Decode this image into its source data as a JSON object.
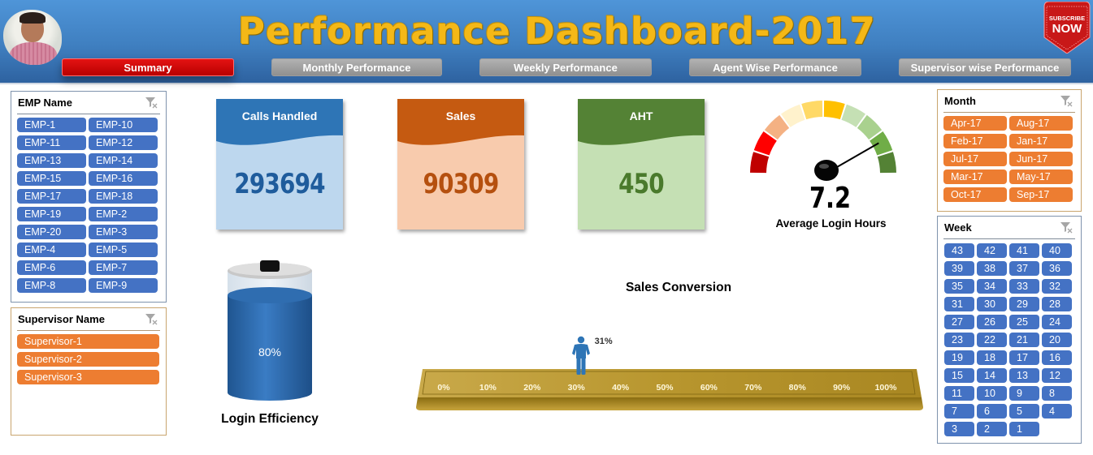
{
  "header": {
    "title": "Performance Dashboard-2017",
    "subscribe_line1": "SUBSCRIBE",
    "subscribe_line2": "NOW",
    "nav": [
      {
        "label": "Summary",
        "active": true
      },
      {
        "label": "Monthly Performance",
        "active": false
      },
      {
        "label": "Weekly Performance",
        "active": false
      },
      {
        "label": "Agent Wise Performance",
        "active": false
      },
      {
        "label": "Supervisor wise Performance",
        "active": false
      }
    ]
  },
  "slicers": {
    "emp": {
      "title": "EMP Name",
      "items": [
        "EMP-1",
        "EMP-10",
        "EMP-11",
        "EMP-12",
        "EMP-13",
        "EMP-14",
        "EMP-15",
        "EMP-16",
        "EMP-17",
        "EMP-18",
        "EMP-19",
        "EMP-2",
        "EMP-20",
        "EMP-3",
        "EMP-4",
        "EMP-5",
        "EMP-6",
        "EMP-7",
        "EMP-8",
        "EMP-9"
      ]
    },
    "supervisor": {
      "title": "Supervisor Name",
      "items": [
        "Supervisor-1",
        "Supervisor-2",
        "Supervisor-3"
      ]
    },
    "month": {
      "title": "Month",
      "items": [
        "Apr-17",
        "Aug-17",
        "Feb-17",
        "Jan-17",
        "Jul-17",
        "Jun-17",
        "Mar-17",
        "May-17",
        "Oct-17",
        "Sep-17"
      ]
    },
    "week": {
      "title": "Week",
      "items": [
        "43",
        "42",
        "41",
        "40",
        "39",
        "38",
        "37",
        "36",
        "35",
        "34",
        "33",
        "32",
        "31",
        "30",
        "29",
        "28",
        "27",
        "26",
        "25",
        "24",
        "23",
        "22",
        "21",
        "20",
        "19",
        "18",
        "17",
        "16",
        "15",
        "14",
        "13",
        "12",
        "11",
        "10",
        "9",
        "8",
        "7",
        "6",
        "5",
        "4",
        "3",
        "2",
        "1"
      ]
    }
  },
  "kpis": [
    {
      "title": "Calls Handled",
      "value": "293694",
      "header_color": "#2e75b6",
      "body_color": "#bdd7ee",
      "value_color": "#1f5c9c"
    },
    {
      "title": "Sales",
      "value": "90309",
      "header_color": "#c55a11",
      "body_color": "#f8cbad",
      "value_color": "#b5500f"
    },
    {
      "title": "AHT",
      "value": "450",
      "header_color": "#548235",
      "body_color": "#c5e0b4",
      "value_color": "#4a7a2c"
    }
  ],
  "gauge": {
    "label": "Average Login Hours",
    "value": "7.2",
    "value_fraction": 0.84,
    "segment_colors": [
      "#c00000",
      "#ff0000",
      "#f4b183",
      "#fff2cc",
      "#ffd966",
      "#ffc000",
      "#c5e0b4",
      "#a9d18e",
      "#70ad47",
      "#548235"
    ]
  },
  "login_efficiency": {
    "label": "Login Efficiency",
    "value_text": "80%",
    "fill_fraction": 0.8
  },
  "sales_conversion": {
    "title": "Sales Conversion",
    "value_text": "31%",
    "value_fraction": 0.31,
    "ticks": [
      "0%",
      "10%",
      "20%",
      "30%",
      "40%",
      "50%",
      "60%",
      "70%",
      "80%",
      "90%",
      "100%"
    ]
  }
}
